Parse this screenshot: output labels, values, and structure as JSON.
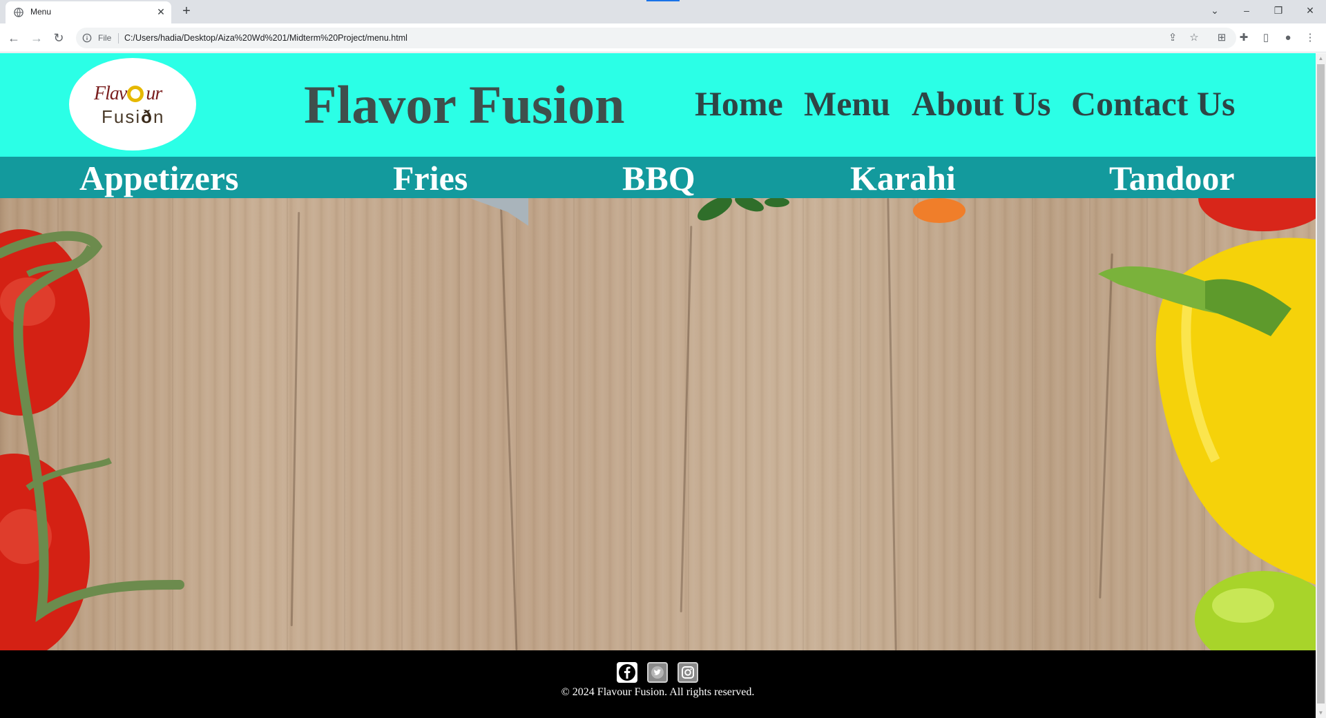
{
  "browser": {
    "tab_title": "Menu",
    "file_label": "File",
    "url": "C:/Users/hadia/Desktop/Aiza%20Wd%201/Midterm%20Project/menu.html",
    "accent": "#1a73e8"
  },
  "site": {
    "logo": {
      "line1": "Flav",
      "line1_end": "ur",
      "line2": "Fusi",
      "line2_end": "n"
    },
    "title": "Flavor Fusion",
    "nav": [
      "Home",
      "Menu",
      "About Us",
      "Contact Us"
    ],
    "categories": [
      "Appetizers",
      "Fries",
      "BBQ",
      "Karahi",
      "Tandoor"
    ],
    "colors": {
      "header_bg": "#2bffe6",
      "category_bg": "#139a9d",
      "footer_bg": "#000000"
    },
    "footer": {
      "social_icons": [
        "facebook-icon",
        "twitter-icon",
        "instagram-icon"
      ],
      "copyright": "© 2024 Flavour Fusion. All rights reserved."
    }
  }
}
